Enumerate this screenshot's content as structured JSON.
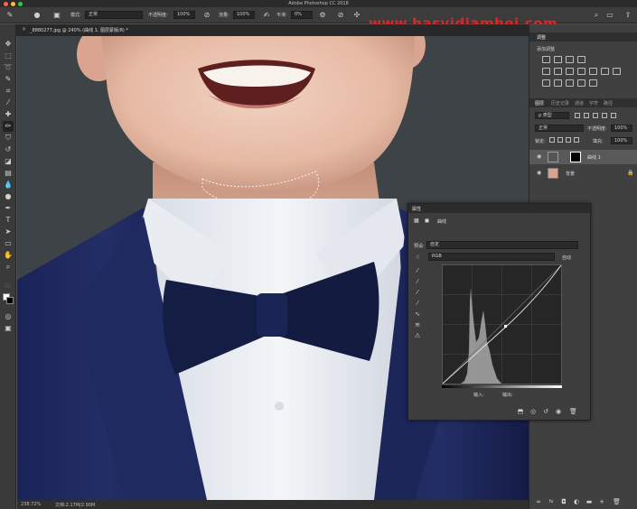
{
  "app": {
    "title": "Adobe Photoshop CC 2018",
    "watermark": "www.hasyidiamhei.com"
  },
  "options_bar": {
    "mode_label": "模式:",
    "mode_value": "正常",
    "opacity_label": "不透明度:",
    "opacity_value": "100%",
    "flow_label": "流量:",
    "flow_value": "100%",
    "smooth_label": "平滑:",
    "smooth_value": "0%"
  },
  "document": {
    "tab_label": "_8880277.jpg @ 240% (曲线 1, 图层蒙版/8) *",
    "zoom": "238.72%",
    "doc_info": "文档:2.17M/2.90M"
  },
  "adjustments_panel": {
    "tab_label": "调整",
    "subtitle": "添加调整"
  },
  "layers_panel": {
    "tabs": [
      "图层",
      "历史记录",
      "通道",
      "字符",
      "路径"
    ],
    "filter_label": "ρ 类型",
    "blend_mode": "正常",
    "opacity_label": "不透明度:",
    "opacity_value": "100%",
    "lock_label": "锁定:",
    "fill_label": "填充:",
    "fill_value": "100%",
    "layers": [
      {
        "name": "曲线 1"
      },
      {
        "name": "背景"
      }
    ]
  },
  "properties_panel": {
    "title": "属性",
    "subtitle": "曲线",
    "preset_label": "预设:",
    "preset_value": "自定",
    "channel_value": "RGB",
    "auto_label": "自动",
    "input_label": "输入:",
    "output_label": "输出:"
  },
  "colors": {
    "watermark": "#d22b2b",
    "panel_bg": "#404040",
    "suit": "#1a2452",
    "shirt": "#eef0f4",
    "bowtie": "#141d44"
  },
  "icons": {
    "brush_tool": "brush-icon",
    "move_tool": "move-icon",
    "eye": "eye-icon"
  }
}
